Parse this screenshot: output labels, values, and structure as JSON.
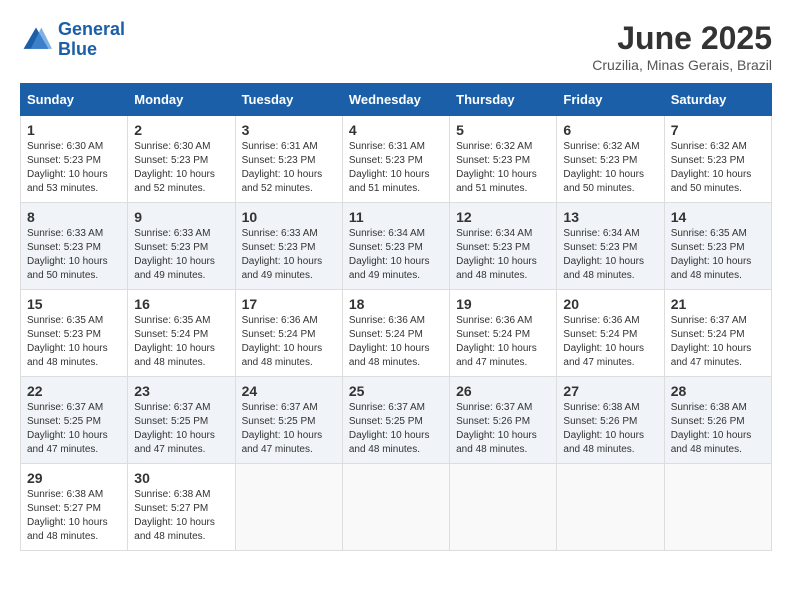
{
  "header": {
    "logo_line1": "General",
    "logo_line2": "Blue",
    "month_title": "June 2025",
    "location": "Cruzilia, Minas Gerais, Brazil"
  },
  "days_of_week": [
    "Sunday",
    "Monday",
    "Tuesday",
    "Wednesday",
    "Thursday",
    "Friday",
    "Saturday"
  ],
  "weeks": [
    [
      {
        "day": "1",
        "sunrise": "6:30 AM",
        "sunset": "5:23 PM",
        "daylight": "10 hours and 53 minutes."
      },
      {
        "day": "2",
        "sunrise": "6:30 AM",
        "sunset": "5:23 PM",
        "daylight": "10 hours and 52 minutes."
      },
      {
        "day": "3",
        "sunrise": "6:31 AM",
        "sunset": "5:23 PM",
        "daylight": "10 hours and 52 minutes."
      },
      {
        "day": "4",
        "sunrise": "6:31 AM",
        "sunset": "5:23 PM",
        "daylight": "10 hours and 51 minutes."
      },
      {
        "day": "5",
        "sunrise": "6:32 AM",
        "sunset": "5:23 PM",
        "daylight": "10 hours and 51 minutes."
      },
      {
        "day": "6",
        "sunrise": "6:32 AM",
        "sunset": "5:23 PM",
        "daylight": "10 hours and 50 minutes."
      },
      {
        "day": "7",
        "sunrise": "6:32 AM",
        "sunset": "5:23 PM",
        "daylight": "10 hours and 50 minutes."
      }
    ],
    [
      {
        "day": "8",
        "sunrise": "6:33 AM",
        "sunset": "5:23 PM",
        "daylight": "10 hours and 50 minutes."
      },
      {
        "day": "9",
        "sunrise": "6:33 AM",
        "sunset": "5:23 PM",
        "daylight": "10 hours and 49 minutes."
      },
      {
        "day": "10",
        "sunrise": "6:33 AM",
        "sunset": "5:23 PM",
        "daylight": "10 hours and 49 minutes."
      },
      {
        "day": "11",
        "sunrise": "6:34 AM",
        "sunset": "5:23 PM",
        "daylight": "10 hours and 49 minutes."
      },
      {
        "day": "12",
        "sunrise": "6:34 AM",
        "sunset": "5:23 PM",
        "daylight": "10 hours and 48 minutes."
      },
      {
        "day": "13",
        "sunrise": "6:34 AM",
        "sunset": "5:23 PM",
        "daylight": "10 hours and 48 minutes."
      },
      {
        "day": "14",
        "sunrise": "6:35 AM",
        "sunset": "5:23 PM",
        "daylight": "10 hours and 48 minutes."
      }
    ],
    [
      {
        "day": "15",
        "sunrise": "6:35 AM",
        "sunset": "5:23 PM",
        "daylight": "10 hours and 48 minutes."
      },
      {
        "day": "16",
        "sunrise": "6:35 AM",
        "sunset": "5:24 PM",
        "daylight": "10 hours and 48 minutes."
      },
      {
        "day": "17",
        "sunrise": "6:36 AM",
        "sunset": "5:24 PM",
        "daylight": "10 hours and 48 minutes."
      },
      {
        "day": "18",
        "sunrise": "6:36 AM",
        "sunset": "5:24 PM",
        "daylight": "10 hours and 48 minutes."
      },
      {
        "day": "19",
        "sunrise": "6:36 AM",
        "sunset": "5:24 PM",
        "daylight": "10 hours and 47 minutes."
      },
      {
        "day": "20",
        "sunrise": "6:36 AM",
        "sunset": "5:24 PM",
        "daylight": "10 hours and 47 minutes."
      },
      {
        "day": "21",
        "sunrise": "6:37 AM",
        "sunset": "5:24 PM",
        "daylight": "10 hours and 47 minutes."
      }
    ],
    [
      {
        "day": "22",
        "sunrise": "6:37 AM",
        "sunset": "5:25 PM",
        "daylight": "10 hours and 47 minutes."
      },
      {
        "day": "23",
        "sunrise": "6:37 AM",
        "sunset": "5:25 PM",
        "daylight": "10 hours and 47 minutes."
      },
      {
        "day": "24",
        "sunrise": "6:37 AM",
        "sunset": "5:25 PM",
        "daylight": "10 hours and 47 minutes."
      },
      {
        "day": "25",
        "sunrise": "6:37 AM",
        "sunset": "5:25 PM",
        "daylight": "10 hours and 48 minutes."
      },
      {
        "day": "26",
        "sunrise": "6:37 AM",
        "sunset": "5:26 PM",
        "daylight": "10 hours and 48 minutes."
      },
      {
        "day": "27",
        "sunrise": "6:38 AM",
        "sunset": "5:26 PM",
        "daylight": "10 hours and 48 minutes."
      },
      {
        "day": "28",
        "sunrise": "6:38 AM",
        "sunset": "5:26 PM",
        "daylight": "10 hours and 48 minutes."
      }
    ],
    [
      {
        "day": "29",
        "sunrise": "6:38 AM",
        "sunset": "5:27 PM",
        "daylight": "10 hours and 48 minutes."
      },
      {
        "day": "30",
        "sunrise": "6:38 AM",
        "sunset": "5:27 PM",
        "daylight": "10 hours and 48 minutes."
      },
      null,
      null,
      null,
      null,
      null
    ]
  ]
}
